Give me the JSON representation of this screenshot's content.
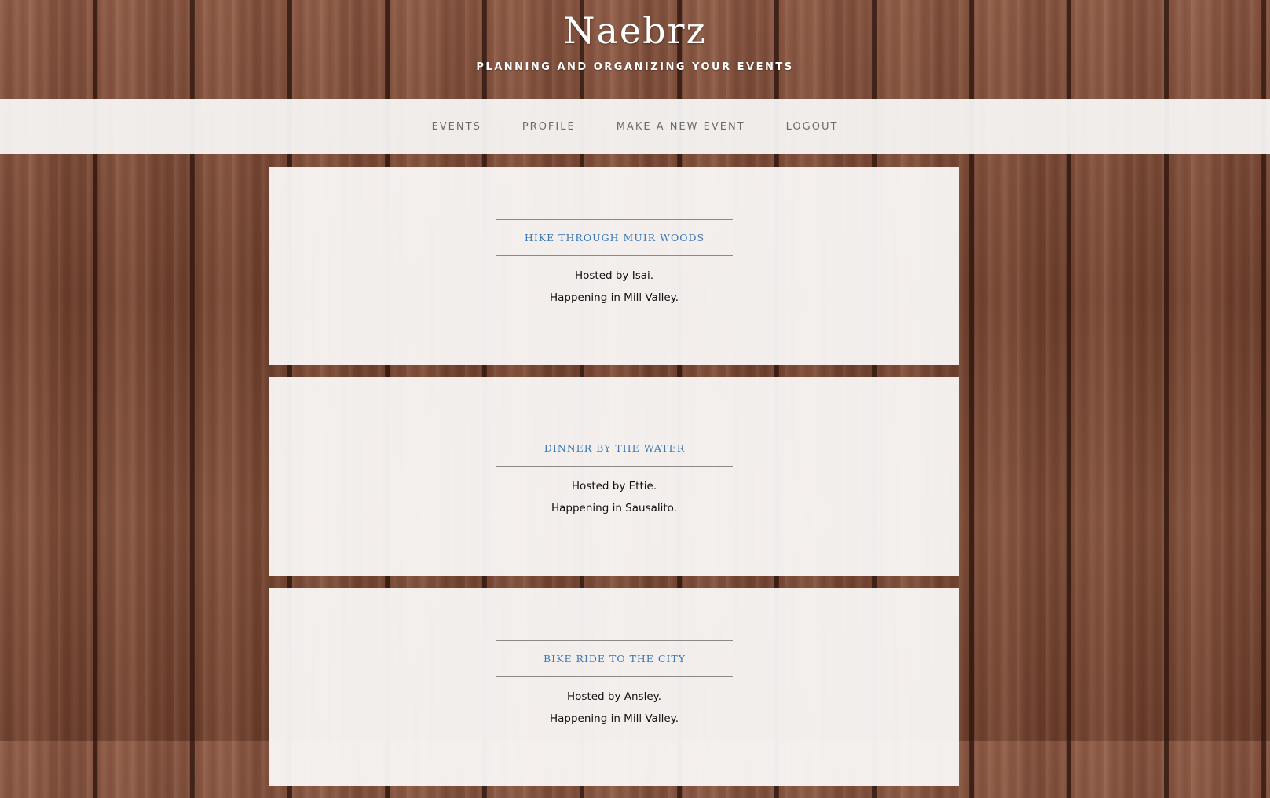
{
  "header": {
    "title": "Naebrz",
    "tagline": "PLANNING AND ORGANIZING YOUR EVENTS"
  },
  "nav": {
    "items": [
      {
        "label": "EVENTS"
      },
      {
        "label": "PROFILE"
      },
      {
        "label": "MAKE A NEW EVENT"
      },
      {
        "label": "LOGOUT"
      }
    ]
  },
  "events": [
    {
      "title": "HIKE THROUGH MUIR WOODS",
      "host": "Hosted by Isai.",
      "location": "Happening in Mill Valley."
    },
    {
      "title": "DINNER BY THE WATER",
      "host": "Hosted by Ettie.",
      "location": "Happening in Sausalito."
    },
    {
      "title": "BIKE RIDE TO THE CITY",
      "host": "Hosted by Ansley.",
      "location": "Happening in Mill Valley."
    }
  ],
  "colors": {
    "event_title": "#3a78b5",
    "nav_text": "#6b6b6b",
    "header_text": "#ffffff"
  }
}
